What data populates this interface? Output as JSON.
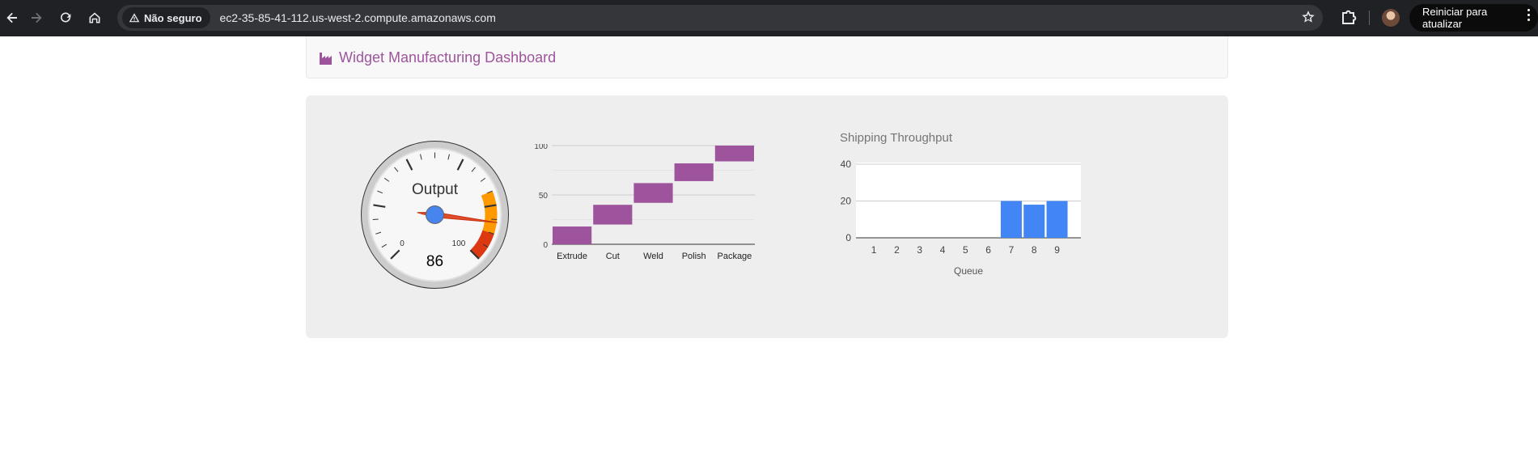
{
  "browser": {
    "security_label": "Não seguro",
    "url": "ec2-35-85-41-112.us-west-2.compute.amazonaws.com",
    "update_label": "Reiniciar para atualizar",
    "icons": [
      "back-icon",
      "forward-icon",
      "reload-icon",
      "home-icon",
      "warning-icon",
      "star-icon",
      "extensions-icon",
      "avatar",
      "menu-icon"
    ]
  },
  "navbar": {
    "brand_title": "Widget Manufacturing Dashboard",
    "brand_icon": "factory-icon",
    "accent_color": "#9e549c"
  },
  "gauge": {
    "label": "Output",
    "value": 86,
    "min": 0,
    "max": 100,
    "min_label": "0",
    "max_label": "100",
    "yellow_range": [
      75,
      90
    ],
    "red_range": [
      90,
      100
    ],
    "yellow_color": "#ff9900",
    "red_color": "#dc3912",
    "needle_color": "#dc3912",
    "hub_color": "#4684ee"
  },
  "chart_data": [
    {
      "type": "bar",
      "subtype": "floating-bar",
      "title": "",
      "categories": [
        "Extrude",
        "Cut",
        "Weld",
        "Polish",
        "Package"
      ],
      "ranges": [
        [
          0,
          18
        ],
        [
          20,
          40
        ],
        [
          42,
          62
        ],
        [
          64,
          82
        ],
        [
          84,
          100
        ]
      ],
      "ylim": [
        0,
        100
      ],
      "yticks": [
        "0",
        "50",
        "100"
      ],
      "grid": true,
      "color": "#9e549c"
    },
    {
      "type": "bar",
      "title": "Shipping Throughput",
      "xlabel": "Queue",
      "ylabel": "",
      "categories": [
        "1",
        "2",
        "3",
        "4",
        "5",
        "6",
        "7",
        "8",
        "9"
      ],
      "values": [
        0,
        0,
        0,
        0,
        0,
        0,
        20,
        18,
        20
      ],
      "ylim": [
        0,
        40
      ],
      "yticks": [
        "0",
        "20",
        "40"
      ],
      "grid": true,
      "color": "#4285f4"
    }
  ]
}
